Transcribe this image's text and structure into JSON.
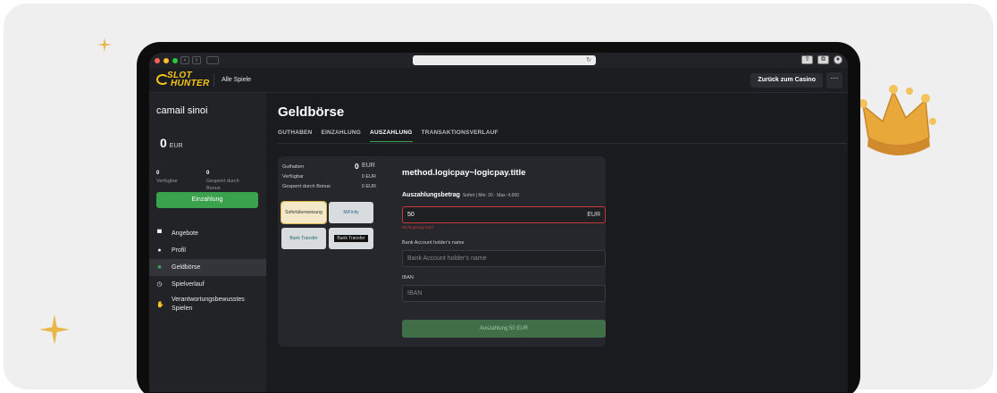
{
  "browser": {
    "traffic_lights": [
      "#ff5f57",
      "#febc2e",
      "#28c840"
    ],
    "reload_glyph": "↻"
  },
  "header": {
    "logo_line1": "SLOT",
    "logo_line2": "HUNTER",
    "nav_link": "Alle Spiele",
    "back_button": "Zurück zum Casino",
    "more_button": "···"
  },
  "sidebar": {
    "username": "camail sinoi",
    "balance_value": "0",
    "balance_currency": "EUR",
    "available_value": "0",
    "available_label": "Verfügbar",
    "locked_value": "0",
    "locked_label": "Gesperrt durch Bonus",
    "deposit_button": "Einzahlung",
    "items": [
      {
        "label": "Angebote",
        "icon": "gift-icon",
        "glyph": "▀"
      },
      {
        "label": "Profil",
        "icon": "user-icon",
        "glyph": "●"
      },
      {
        "label": "Geldbörse",
        "icon": "wallet-icon",
        "glyph": "■",
        "active": true
      },
      {
        "label": "Spielverlauf",
        "icon": "clock-icon",
        "glyph": "◷"
      },
      {
        "label": "Verantwortungsbewusstes Spielen",
        "icon": "hand-icon",
        "glyph": "✋"
      }
    ]
  },
  "main": {
    "title": "Geldbörse",
    "tabs": [
      "GUTHABEN",
      "EINZAHLUNG",
      "AUSZAHLUNG",
      "TRANSAKTIONSVERLAUF"
    ],
    "active_tab": "AUSZAHLUNG",
    "summary": {
      "guthaben_label": "Guthaben",
      "guthaben_value": "0",
      "guthaben_currency": "EUR",
      "verfuegbar_label": "Verfügbar",
      "verfuegbar_value": "0 EUR",
      "gesperrt_label": "Gesperrt durch Bonus",
      "gesperrt_value": "0 EUR"
    },
    "payment_methods": [
      {
        "name": "Sofortüberweisung",
        "selected": true
      },
      {
        "name": "MiFinity",
        "selected": false
      },
      {
        "name": "Bank Transfer",
        "selected": false
      },
      {
        "name": "Bank Transfer",
        "selected": false
      }
    ],
    "form": {
      "method_title": "method.logicpay~logicpay.title",
      "amount_label": "Auszahlungsbetrag",
      "amount_hint": "Sofort | Min: 20 · Max: 4,000",
      "amount_value": "50",
      "amount_currency": "EUR",
      "amount_error": "Nicht genug Geld",
      "holder_label": "Bank Account holder's name",
      "holder_placeholder": "Bank Account holder's name",
      "iban_label": "IBAN",
      "iban_placeholder": "IBAN",
      "submit_label": "Auszahlung 50 EUR"
    }
  }
}
